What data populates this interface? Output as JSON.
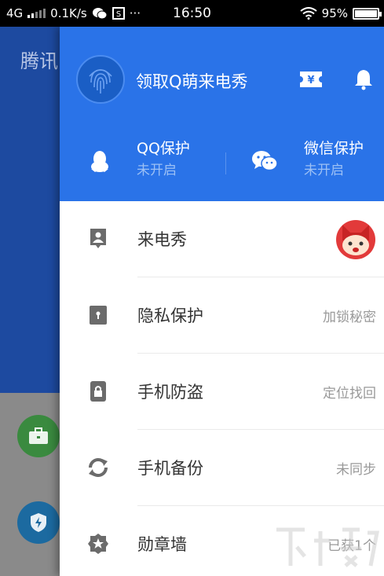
{
  "status_bar": {
    "network": "4G",
    "speed": "0.1K/s",
    "time": "16:50",
    "battery": "95%",
    "battery_level": 0.95
  },
  "background_app": {
    "title_partial": "腾讯"
  },
  "drawer": {
    "promo_text": "领取Q萌来电秀",
    "protections": [
      {
        "title": "QQ保护",
        "status": "未开启"
      },
      {
        "title": "微信保护",
        "status": "未开启"
      }
    ],
    "menu": [
      {
        "label": "来电秀",
        "value": ""
      },
      {
        "label": "隐私保护",
        "value": "加锁秘密"
      },
      {
        "label": "手机防盗",
        "value": "定位找回"
      },
      {
        "label": "手机备份",
        "value": "未同步"
      },
      {
        "label": "勋章墙",
        "value": "已获1个"
      }
    ]
  },
  "colors": {
    "header_blue": "#2a73e8",
    "bg_blue": "#1d4aa0",
    "icon_gray": "#6b6b6b"
  }
}
